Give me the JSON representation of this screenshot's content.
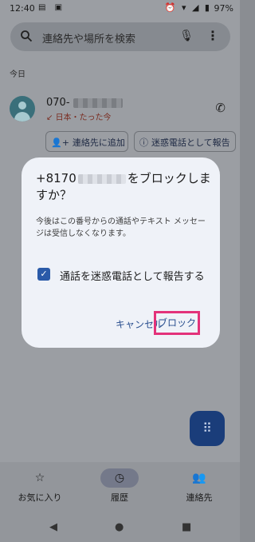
{
  "status_bar": {
    "time": "12:40",
    "battery": "97%"
  },
  "search": {
    "placeholder": "連絡先や場所を検索"
  },
  "section": {
    "today": "今日"
  },
  "call_log": {
    "number_prefix": "070-",
    "detail": "日本・たった今",
    "add_contact": "連絡先に追加",
    "report_spam": "迷惑電話として報告"
  },
  "dialog": {
    "title_prefix": "+8170",
    "title_suffix": "をブロックしますか？",
    "message": "今後はこの番号からの通話やテキスト メッセージは受信しなくなります。",
    "checkbox_label": "通話を迷惑電話として報告する",
    "checkbox_checked": true,
    "cancel_label": "キャンセル",
    "block_label": "ブロック",
    "highlight_color": "#e3327a"
  },
  "bottom_nav": {
    "favorites": "お気に入り",
    "history": "履歴",
    "contacts": "連絡先"
  }
}
